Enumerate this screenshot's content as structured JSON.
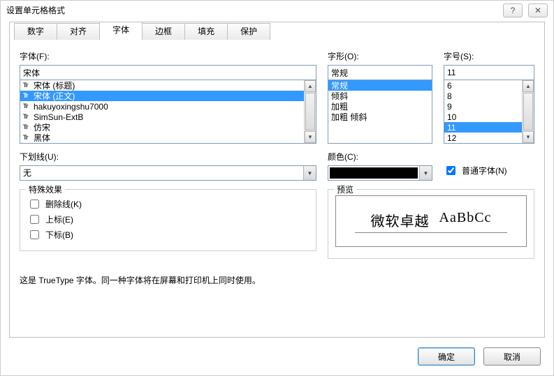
{
  "title": "设置单元格格式",
  "window_buttons": {
    "help": "?",
    "close": "✕"
  },
  "tabs": [
    "数字",
    "对齐",
    "字体",
    "边框",
    "填充",
    "保护"
  ],
  "active_tab_index": 2,
  "font": {
    "label": "字体(F):",
    "value": "宋体",
    "items": [
      {
        "name": "宋体 (标题)",
        "selected": false
      },
      {
        "name": "宋体 (正文)",
        "selected": true
      },
      {
        "name": "hakuyoxingshu7000",
        "selected": false
      },
      {
        "name": "SimSun-ExtB",
        "selected": false
      },
      {
        "name": "仿宋",
        "selected": false
      },
      {
        "name": "黑体",
        "selected": false
      }
    ]
  },
  "style": {
    "label": "字形(O):",
    "value": "常规",
    "items": [
      {
        "name": "常规",
        "selected": true
      },
      {
        "name": "倾斜",
        "selected": false
      },
      {
        "name": "加粗",
        "selected": false
      },
      {
        "name": "加粗 倾斜",
        "selected": false
      }
    ]
  },
  "size": {
    "label": "字号(S):",
    "value": "11",
    "items": [
      {
        "name": "6",
        "selected": false
      },
      {
        "name": "8",
        "selected": false
      },
      {
        "name": "9",
        "selected": false
      },
      {
        "name": "10",
        "selected": false
      },
      {
        "name": "11",
        "selected": true
      },
      {
        "name": "12",
        "selected": false
      }
    ]
  },
  "underline": {
    "label": "下划线(U):",
    "value": "无"
  },
  "color": {
    "label": "颜色(C):",
    "value": "#000000"
  },
  "normal_font": {
    "label": "普通字体(N)",
    "checked": true
  },
  "effects": {
    "label": "特殊效果",
    "strike": {
      "label": "删除线(K)",
      "checked": false
    },
    "super": {
      "label": "上标(E)",
      "checked": false
    },
    "sub": {
      "label": "下标(B)",
      "checked": false
    }
  },
  "preview": {
    "label": "预览",
    "sample_cn": "微软卓越",
    "sample_en": "AaBbCc"
  },
  "hint": "这是 TrueType 字体。同一种字体将在屏幕和打印机上同时使用。",
  "buttons": {
    "ok": "确定",
    "cancel": "取消"
  },
  "icons": {
    "tt": "Tr",
    "up": "▲",
    "down": "▼",
    "drop": "▼"
  }
}
